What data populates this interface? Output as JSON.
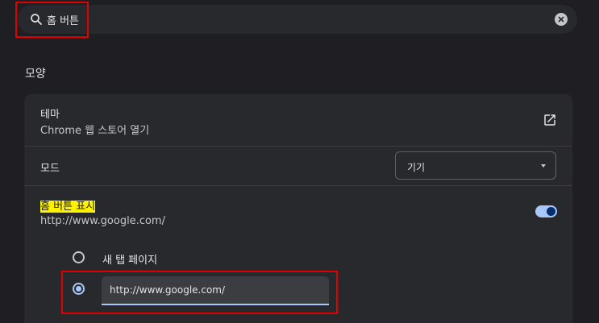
{
  "search": {
    "value": "홈 버튼"
  },
  "section": {
    "title": "모양"
  },
  "theme": {
    "title": "테마",
    "subtitle": "Chrome 웹 스토어 열기"
  },
  "mode": {
    "title": "모드",
    "selected": "기기"
  },
  "home_button": {
    "title": "홈 버튼 표시",
    "subtitle": "http://www.google.com/",
    "enabled": true,
    "options": [
      {
        "label": "새 탭 페이지",
        "checked": false
      },
      {
        "value": "http://www.google.com/",
        "checked": true
      }
    ]
  },
  "colors": {
    "accent": "#a8c7fa",
    "highlight": "#fff200",
    "annotation": "#e00000"
  }
}
